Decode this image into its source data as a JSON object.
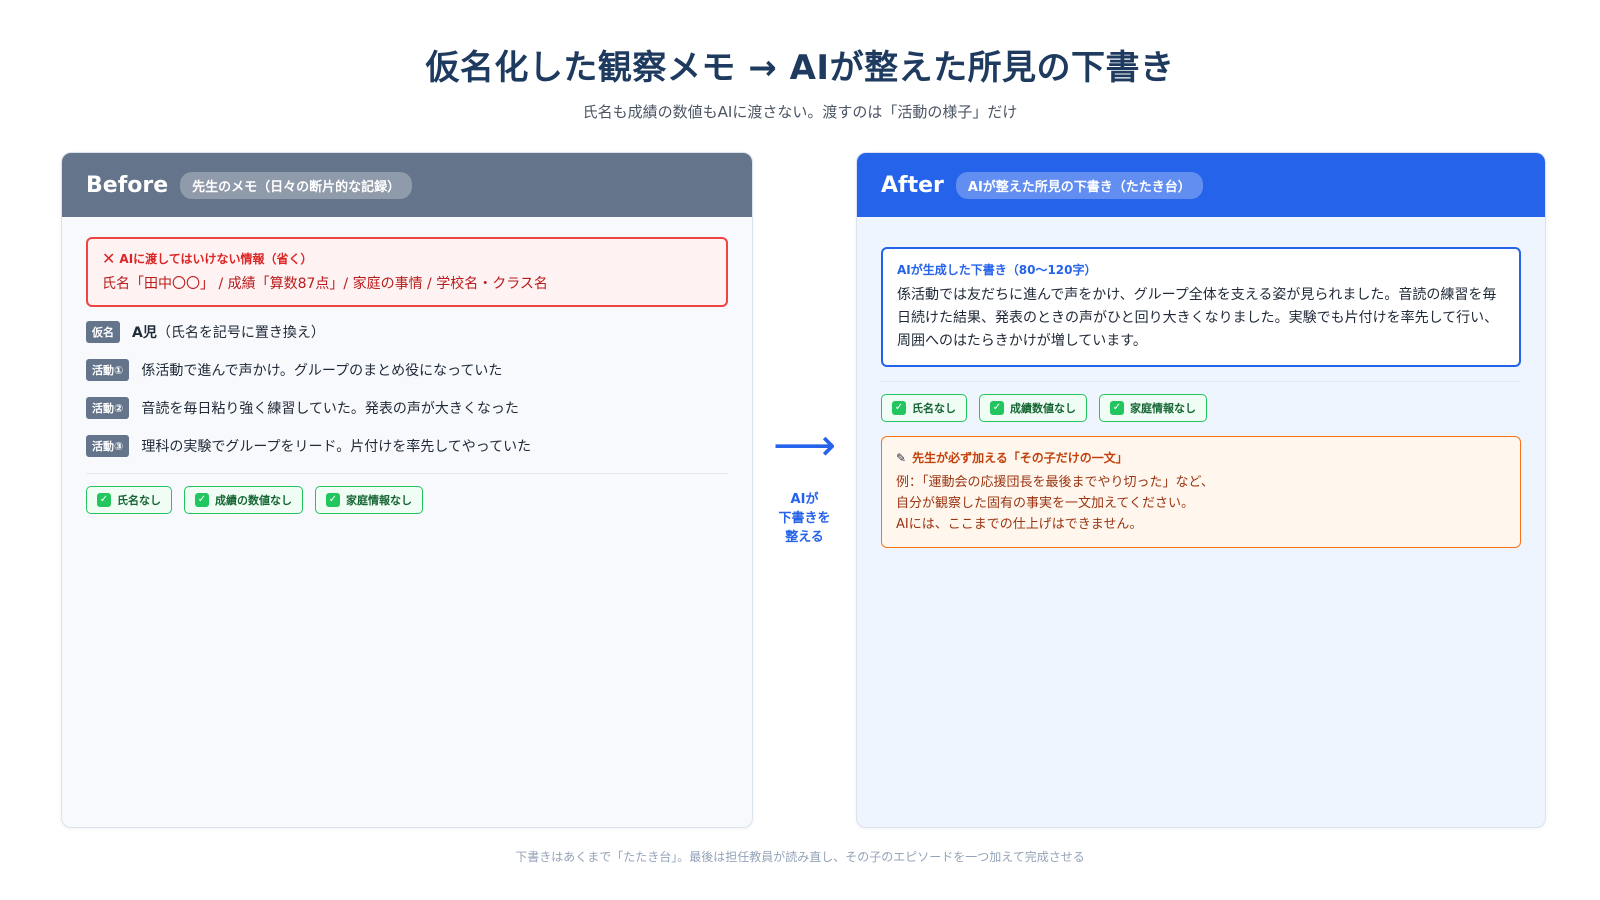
{
  "title": "仮名化した観察メモ → AIが整えた所見の下書き",
  "subtitle": "氏名も成績の数値もAIに渡さない。渡すのは「活動の様子」だけ",
  "before": {
    "heading": "Before",
    "pill": "先生のメモ（日々の断片的な記録）",
    "warning": {
      "title": "AIに渡してはいけない情報（省く）",
      "text": "氏名「田中〇〇」 / 成績「算数87点」/ 家庭の事情 / 学校名・クラス名"
    },
    "rows": [
      {
        "tag": "仮名",
        "strong": "A児",
        "text": "（氏名を記号に置き換え）"
      },
      {
        "tag": "活動①",
        "text": "係活動で進んで声かけ。グループのまとめ役になっていた"
      },
      {
        "tag": "活動②",
        "text": "音読を毎日粘り強く練習していた。発表の声が大きくなった"
      },
      {
        "tag": "活動③",
        "text": "理科の実験でグループをリード。片付けを率先してやっていた"
      }
    ],
    "chips": [
      "氏名なし",
      "成績の数値なし",
      "家庭情報なし"
    ]
  },
  "arrow": {
    "icon": "right-arrow-icon",
    "label": "AIが\n下書きを\n整える"
  },
  "after": {
    "heading": "After",
    "pill": "AIが整えた所見の下書き（たたき台）",
    "draft": {
      "title": "AIが生成した下書き（80〜120字）",
      "text": "係活動では友だちに進んで声をかけ、グループ全体を支える姿が見られました。音読の練習を毎日続けた結果、発表のときの声がひと回り大きくなりました。実験でも片付けを率先して行い、周囲へのはたらきかけが増しています。"
    },
    "chips": [
      "氏名なし",
      "成績数値なし",
      "家庭情報なし"
    ],
    "teacher": {
      "title": "先生が必ず加える「その子だけの一文」",
      "lines": [
        "例：「運動会の応援団長を最後までやり切った」など、",
        "自分が観察した固有の事実を一文加えてください。",
        "AIには、ここまでの仕上げはできません。"
      ]
    }
  },
  "footer": "下書きはあくまで「たたき台」。最後は担任教員が読み直し、その子のエピソードを一つ加えて完成させる",
  "colors": {
    "before_header": "#64748b",
    "after_header": "#2563eb",
    "warning": "#ef4444",
    "ok": "#22c55e",
    "note": "#f97316"
  }
}
